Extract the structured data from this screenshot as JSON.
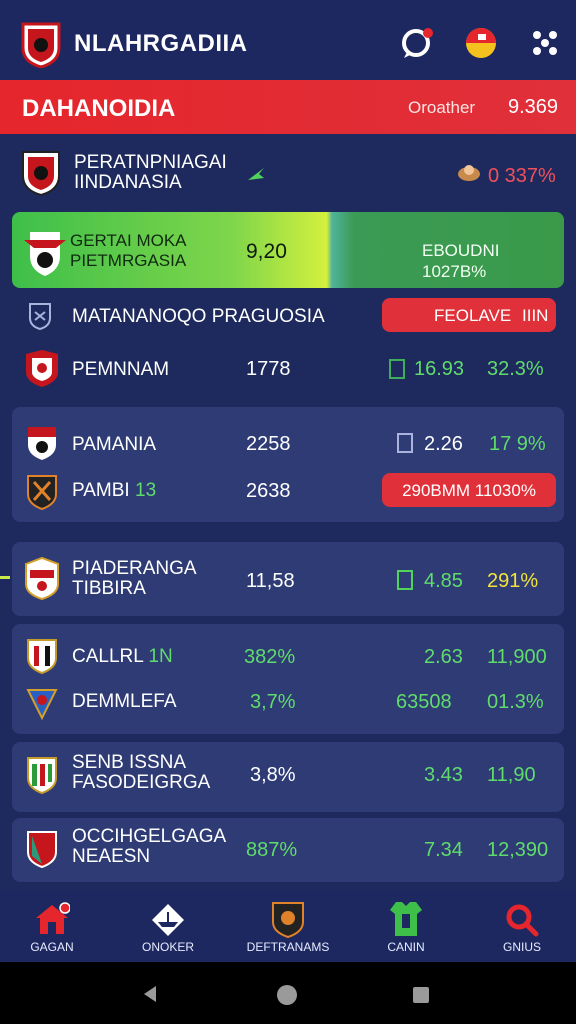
{
  "app": {
    "title": "NLAHRGADIIA"
  },
  "header": {
    "league": "DAHANOIDIA",
    "label": "Oroather",
    "value": "9.369"
  },
  "top_team": {
    "name_line1": "PERATNPNIAGAI",
    "name_line2": "IINDANASIA",
    "value": "0 337%"
  },
  "featured": {
    "name_line1": "GERTAI MOKA",
    "name_line2": "PIETMRGASIA",
    "score": "9,20",
    "right_label": "EBOUDNI 1027B%"
  },
  "section": {
    "title": "MATANANOQO PRAGUOSIA",
    "pill": "FEOLAVE",
    "pill_extra": "IIIN"
  },
  "rows": [
    {
      "name": "PEMNNAM",
      "value": "1778",
      "v2": "16.93",
      "v3": "32.3%"
    },
    {
      "name": "PAMANIA",
      "value": "2258",
      "v2": "2.26",
      "v3": "17 9%"
    },
    {
      "name": "PAMBI",
      "name_extra": "13",
      "value": "2638",
      "pill": "290BMM 11030%"
    },
    {
      "name_line1": "PIADERANGA",
      "name_line2": "TIBBIRA",
      "value": "11,58",
      "v2": "4.85",
      "v3": "291%"
    },
    {
      "name": "CALLRL",
      "name_extra": "1N",
      "value": "382%",
      "v2": "2.63",
      "v3": "11,900"
    },
    {
      "name": "DEMMLEFA",
      "value": "3,7%",
      "v2": "63508",
      "v3": "01.3%"
    },
    {
      "name_line1": "SENB ISSNA",
      "name_line2": "FASODEIGRGA",
      "value": "3,8%",
      "v2": "3.43",
      "v3": "11,90"
    },
    {
      "name_line1": "OCCIHGELGAGA",
      "name_line2": "NEAESN",
      "value": "887%",
      "v2": "7.34",
      "v3": "12,390"
    }
  ],
  "nav": [
    {
      "label": "GAGAN",
      "icon": "home-icon"
    },
    {
      "label": "ONOKER",
      "icon": "ship-icon"
    },
    {
      "label": "DEFTRANAMS",
      "icon": "crest-icon"
    },
    {
      "label": "CANIN",
      "icon": "jersey-icon"
    },
    {
      "label": "GNIUS",
      "icon": "search-icon"
    }
  ],
  "colors": {
    "background": "#1e2a5e",
    "red": "#e5262c",
    "green": "#5fdc6b",
    "yellow": "#f2e23c",
    "card": "#2e3b75"
  }
}
